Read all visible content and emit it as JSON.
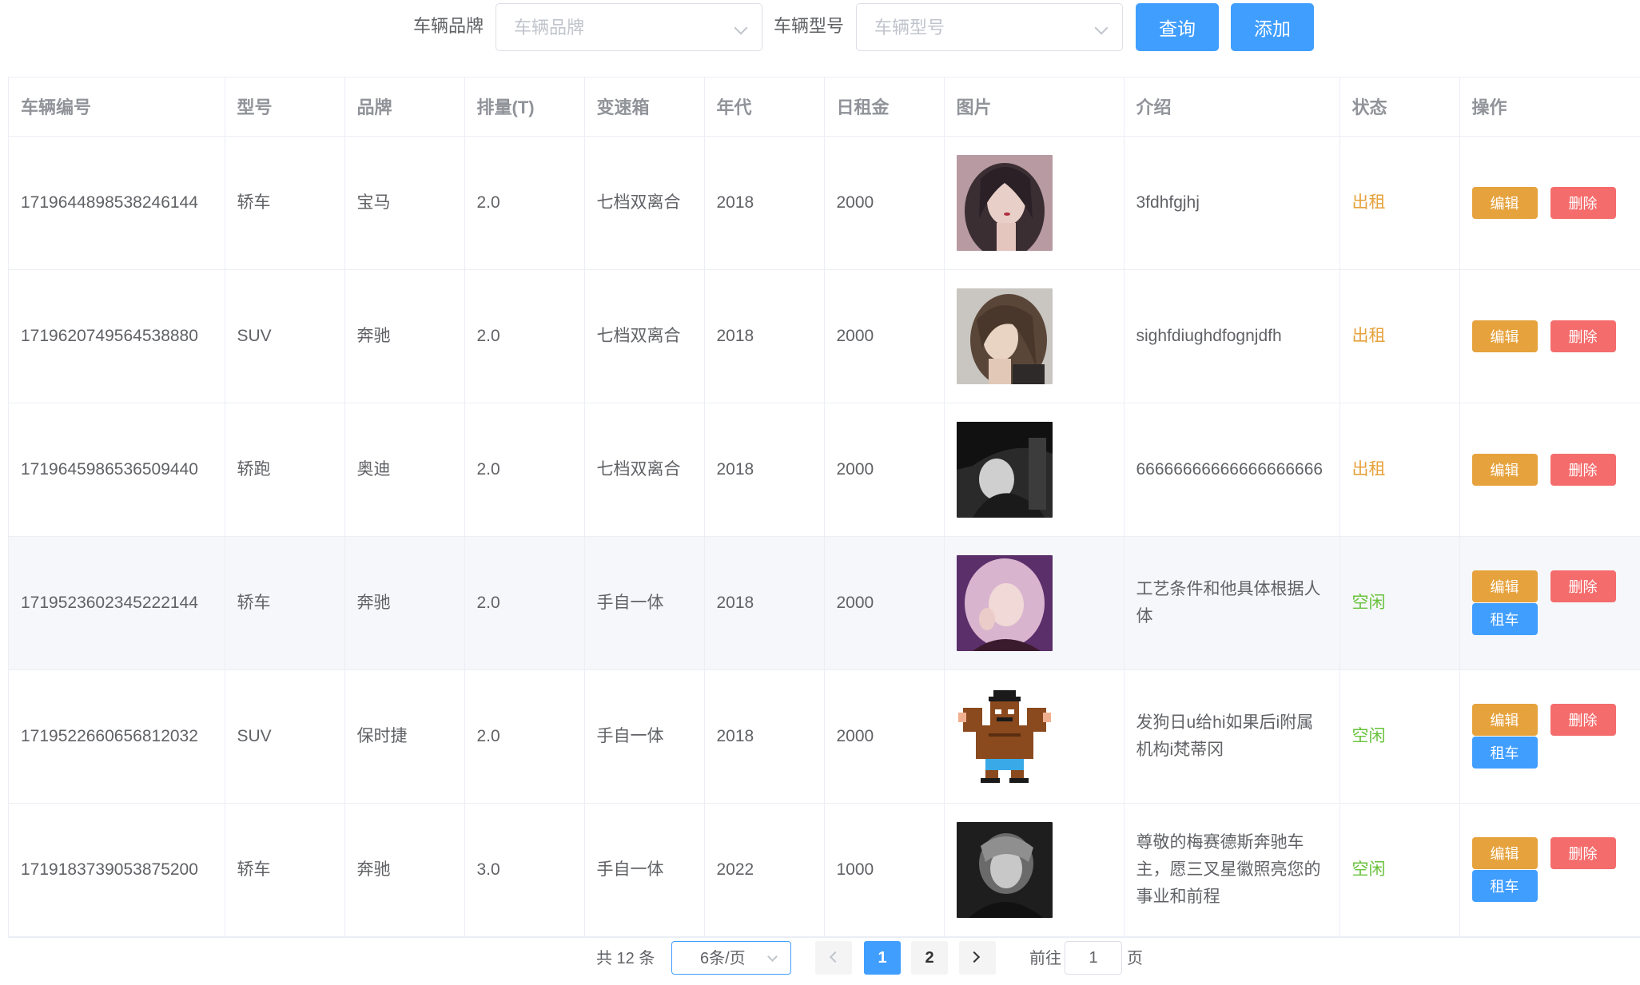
{
  "search": {
    "brand_label": "车辆品牌",
    "brand_placeholder": "车辆品牌",
    "model_label": "车辆型号",
    "model_placeholder": "车辆型号",
    "query_button": "查询",
    "add_button": "添加"
  },
  "table": {
    "columns": [
      "车辆编号",
      "型号",
      "品牌",
      "排量(T)",
      "变速箱",
      "年代",
      "日租金",
      "图片",
      "介绍",
      "状态",
      "操作"
    ],
    "rows": [
      {
        "id": "1719644898538246144",
        "model": "轿车",
        "brand": "宝马",
        "displacement": "2.0",
        "gearbox": "七档双离合",
        "year": "2018",
        "rent": "2000",
        "image": "portrait-woman-dark-hair",
        "intro": "3fdhfgjhj",
        "status": "出租"
      },
      {
        "id": "1719620749564538880",
        "model": "SUV",
        "brand": "奔驰",
        "displacement": "2.0",
        "gearbox": "七档双离合",
        "year": "2018",
        "rent": "2000",
        "image": "portrait-woman-brown-hair",
        "intro": "sighfdiughdfognjdfh",
        "status": "出租"
      },
      {
        "id": "1719645986536509440",
        "model": "轿跑",
        "brand": "奥迪",
        "displacement": "2.0",
        "gearbox": "七档双离合",
        "year": "2018",
        "rent": "2000",
        "image": "portrait-woman-hat-bw",
        "intro": "66666666666666666666",
        "status": "出租"
      },
      {
        "id": "1719523602345222144",
        "model": "轿车",
        "brand": "奔驰",
        "displacement": "2.0",
        "gearbox": "手自一体",
        "year": "2018",
        "rent": "2000",
        "image": "portrait-woman-pink-hair",
        "intro": "工艺条件和他具体根据人体",
        "status": "空闲"
      },
      {
        "id": "1719522660656812032",
        "model": "SUV",
        "brand": "保时捷",
        "displacement": "2.0",
        "gearbox": "手自一体",
        "year": "2018",
        "rent": "2000",
        "image": "pixel-muscle-man",
        "intro": "发狗日u给hi如果后i附属机构i梵蒂冈",
        "status": "空闲"
      },
      {
        "id": "1719183739053875200",
        "model": "轿车",
        "brand": "奔驰",
        "displacement": "3.0",
        "gearbox": "手自一体",
        "year": "2022",
        "rent": "1000",
        "image": "portrait-woman-bw",
        "intro": "尊敬的梅赛德斯奔驰车主，愿三叉星徽照亮您的事业和前程",
        "status": "空闲"
      }
    ],
    "actions": {
      "edit": "编辑",
      "delete": "删除",
      "rent": "租车"
    }
  },
  "pagination": {
    "total": "共 12 条",
    "page_size": "6条/页",
    "pages": [
      "1",
      "2"
    ],
    "current_page": "1",
    "goto_label": "前往",
    "goto_value": "1",
    "page_suffix": "页"
  },
  "colors": {
    "primary": "#409eff",
    "warning": "#e6a23c",
    "danger": "#f56c6c",
    "success": "#67c23a"
  }
}
